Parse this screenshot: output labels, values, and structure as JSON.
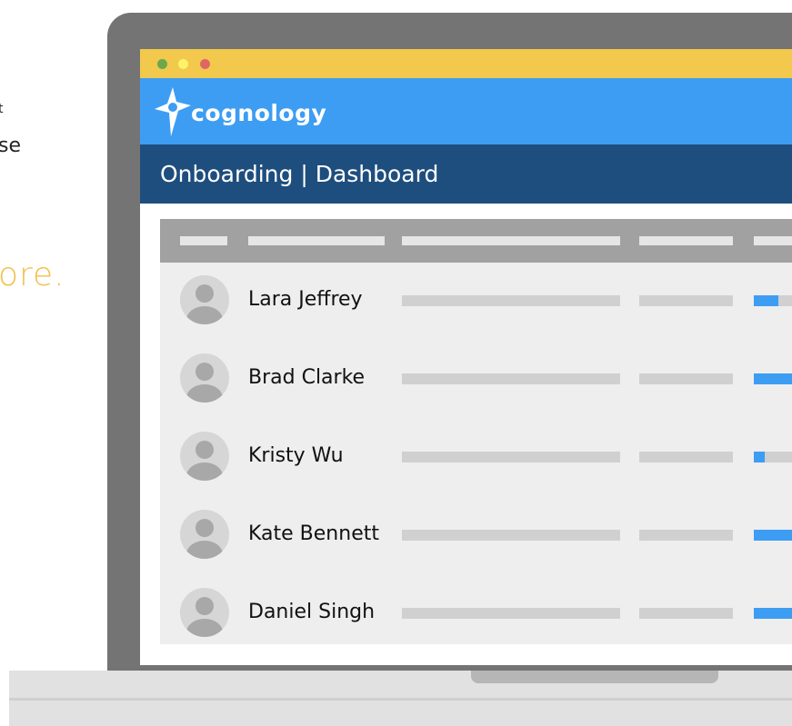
{
  "marketing": {
    "fragment_a": "t",
    "fragment_b": "se",
    "fragment_c": "ore."
  },
  "window": {
    "controls": [
      "close",
      "minimize",
      "maximize"
    ]
  },
  "brand": {
    "name": "cognology",
    "icon": "cognology-logo-icon"
  },
  "nav": {
    "title": "Onboarding | Dashboard"
  },
  "table": {
    "columns": [
      "",
      "",
      "",
      "",
      ""
    ],
    "rows": [
      {
        "name": "Lara Jeffrey",
        "progress": 0.45
      },
      {
        "name": "Brad Clarke",
        "progress": 1.0
      },
      {
        "name": "Kristy Wu",
        "progress": 0.2
      },
      {
        "name": "Kate Bennett",
        "progress": 1.0
      },
      {
        "name": "Daniel Singh",
        "progress": 1.0
      }
    ]
  },
  "colors": {
    "titlebar": "#f2c94c",
    "brandbar": "#3d9df3",
    "navbar": "#1e4e7e",
    "accent": "#f2c04b"
  }
}
